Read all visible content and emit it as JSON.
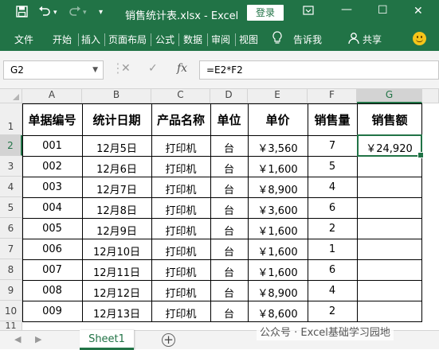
{
  "window": {
    "title": "销售统计表.xlsx  -  Excel",
    "login_label": "登录",
    "minimize": "—",
    "maximize": "☐",
    "close": "✕",
    "restore": "⧉"
  },
  "ribbon": {
    "tabs": [
      "文件",
      "开始",
      "插入",
      "页面布局",
      "公式",
      "数据",
      "审阅",
      "视图"
    ],
    "tell_me": "告诉我",
    "share": "共享"
  },
  "formula_bar": {
    "name_box": "G2",
    "formula": "=E2*F2",
    "fx_label": "fx"
  },
  "columns": [
    "A",
    "B",
    "C",
    "D",
    "E",
    "F",
    "G"
  ],
  "selected_cell": "G2",
  "rows": [
    "1",
    "2",
    "3",
    "4",
    "5",
    "6",
    "7",
    "8",
    "9",
    "10",
    "11"
  ],
  "table": {
    "headers": [
      "单据编号",
      "统计日期",
      "产品名称",
      "单位",
      "单价",
      "销售量",
      "销售额"
    ],
    "data": [
      [
        "001",
        "12月5日",
        "打印机",
        "台",
        "￥3,560",
        "7",
        "￥24,920"
      ],
      [
        "002",
        "12月6日",
        "打印机",
        "台",
        "￥1,600",
        "5",
        ""
      ],
      [
        "003",
        "12月7日",
        "打印机",
        "台",
        "￥8,900",
        "4",
        ""
      ],
      [
        "004",
        "12月8日",
        "打印机",
        "台",
        "￥3,600",
        "6",
        ""
      ],
      [
        "005",
        "12月9日",
        "打印机",
        "台",
        "￥1,600",
        "2",
        ""
      ],
      [
        "006",
        "12月10日",
        "打印机",
        "台",
        "￥1,600",
        "1",
        ""
      ],
      [
        "007",
        "12月11日",
        "打印机",
        "台",
        "￥1,600",
        "6",
        ""
      ],
      [
        "008",
        "12月12日",
        "打印机",
        "台",
        "￥8,900",
        "4",
        ""
      ],
      [
        "009",
        "12月13日",
        "打印机",
        "台",
        "￥8,600",
        "2",
        ""
      ]
    ]
  },
  "sheets": {
    "active": "Sheet1",
    "add": "+"
  },
  "watermark": "公众号 · Excel基础学习园地",
  "colors": {
    "accent": "#217346",
    "grid_border": "#000000",
    "header_bg": "#efefef"
  }
}
